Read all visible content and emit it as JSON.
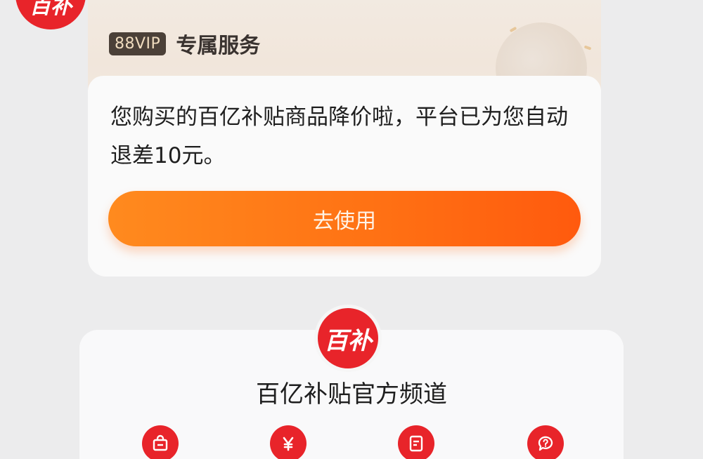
{
  "corner_logo": {
    "text": "百补"
  },
  "vip_card": {
    "badge": "88VIP",
    "title": "专属服务",
    "message": "您购买的百亿补贴商品降价啦，平台已为您自动退差10元。",
    "button_label": "去使用"
  },
  "channel": {
    "logo_text": "百补",
    "title": "百亿补贴官方频道",
    "icons": [
      "shopping-bag-icon",
      "yuan-icon",
      "document-icon",
      "question-icon"
    ]
  },
  "colors": {
    "brand_red": "#e8242a",
    "button_orange_start": "#ff8a1e",
    "button_orange_end": "#ff5a0e",
    "vip_badge_bg": "#4b4038"
  }
}
